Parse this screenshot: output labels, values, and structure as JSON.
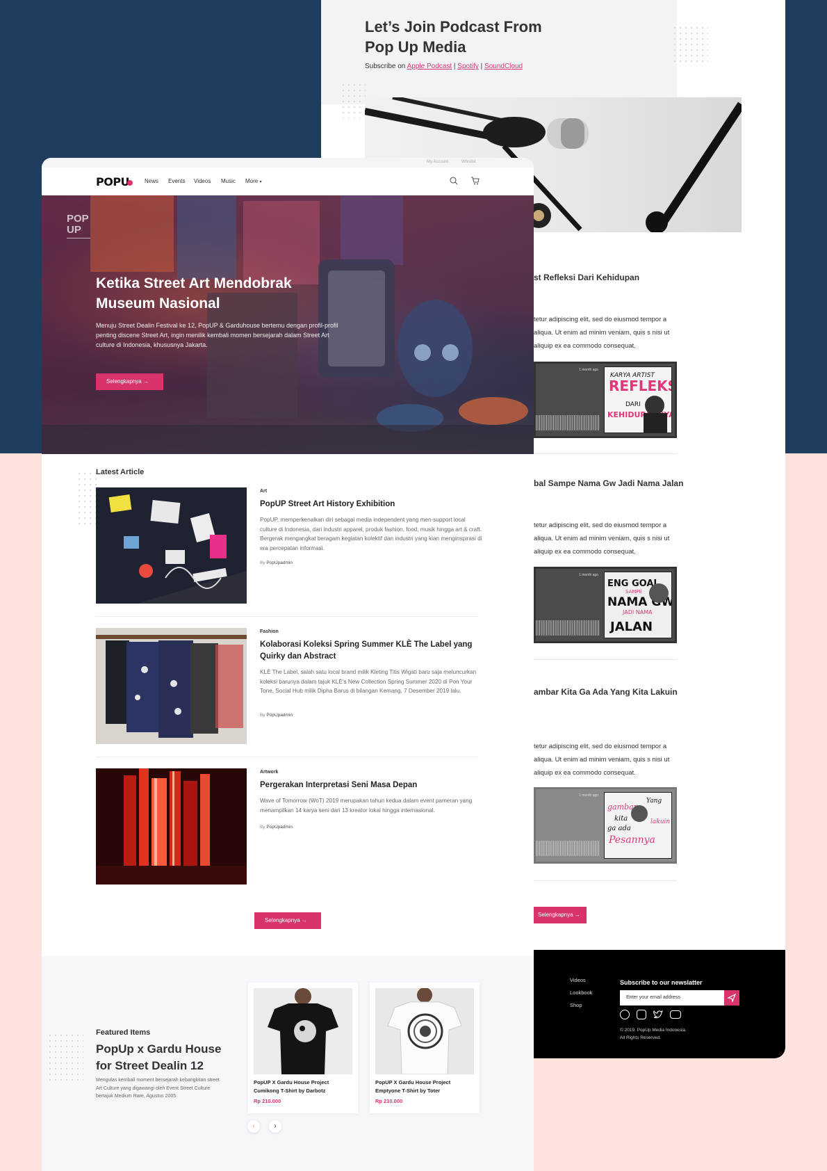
{
  "podcast": {
    "title": "Let’s Join Podcast From Pop Up Media",
    "subscribe_prefix": "Subscribe on",
    "platforms": [
      "Apple Podcast",
      "Spotify",
      "SoundCloud"
    ],
    "separator": "|",
    "episodes": [
      {
        "title": "st Refleksi Dari Kehidupan",
        "text": "tetur adipiscing elit, sed do eiusmod tempor a aliqua. Ut enim ad minim veniam, quis s nisi ut aliquip ex ea commodo consequat.",
        "ago": "1 month ago",
        "cover_text": "KARYA ARTIST REFLEKSI DARI KEHIDUPANNYA"
      },
      {
        "title": "bal Sampe Nama Gw Jadi Nama Jalan",
        "text": "tetur adipiscing elit, sed do eiusmod tempor a aliqua. Ut enim ad minim veniam, quis s nisi ut aliquip ex ea commodo consequat.",
        "ago": "1 month ago",
        "cover_text": "ENG GOAL SAMPE NAMA GW JADI NAMA JALAN"
      },
      {
        "title": "ambar Kita Ga Ada Yang Kita Lakuin",
        "text": "tetur adipiscing elit, sed do eiusmod tempor a aliqua. Ut enim ad minim veniam, quis s nisi ut aliquip ex ea commodo consequat.",
        "ago": "1 month ago",
        "cover_text": "gambar kita ga ada yang kita lakuin Pesannya"
      }
    ],
    "more_label": "Selengkapnya →"
  },
  "footer": {
    "links": [
      "Videos",
      "Lookbook",
      "Shop"
    ],
    "newsletter_title": "Subscribe to our newslatter",
    "email_placeholder": "Enter your email address",
    "copyright_line1": "© 2019. PopUp Media Indonesia.",
    "copyright_line2": "All Rights Reserved."
  },
  "topbar": {
    "account": "My Account",
    "wishlist": "Whislist"
  },
  "nav": {
    "logo": "POPU",
    "items": [
      "News",
      "Events",
      "Videos",
      "Music",
      "More"
    ],
    "more_caret": "▾"
  },
  "hero": {
    "logo": "POP UP",
    "title": "Ketika Street Art Mendobrak Museum Nasional",
    "text": "Menuju Street Dealin Festival ke 12, PopUP & Garduhouse bertemu dengan profil-profil penting discene Street Art, ingin menilik kembali momen bersejarah dalam Street Art culture di Indonesia, khususnya Jakarta.",
    "button": "Selengkapnya →"
  },
  "latest": {
    "heading": "Latest Article",
    "by_prefix": "By",
    "articles": [
      {
        "category": "Art",
        "title": "PopUP Street Art History Exhibition",
        "desc": "PopUP, memperkenalkan diri sebagai media independent yang men-support local culture di Indonesia, dari industri apparel, produk fashion, food, musik hingga art & craft. Bergerak mengangkat beragam kegiatan kolektif dan industri yang kian menginspirasi di era percepatan informasi.",
        "author": "PopUpadmin"
      },
      {
        "category": "Fashion",
        "title": "Kolaborasi Koleksi Spring Summer KLÈ The Label yang Quirky dan Abstract",
        "desc": "KLÈ The Label, salah satu local brand milik Kleting Titis Wigati baru saja meluncurkan koleksi barunya dalam tajuk KLÈ’s New Collection Spring Summer 2020 di Pon Your Tone, Social Hub milik Dipha Barus di bilangan Kemang, 7 Desember 2019 lalu.",
        "author": "PopUpadmin"
      },
      {
        "category": "Artwork",
        "title": "Pergerakan Interpretasi Seni Masa Depan",
        "desc": "Wave of Tomorrow (WoT) 2019 merupakan tahun kedua dalam event pameran yang menampilkan 14 karya seni dari 13 kreator lokal hingga internasional.",
        "author": "PopUpadmin"
      }
    ],
    "more_button": "Selengkapnya →"
  },
  "featured": {
    "label": "Featured Items",
    "title": "PopUp x Gardu House for Street Dealin 12",
    "desc": "Mengulas kembali moment bersejarah kebangkitan street Art Culture yang digawangi oleh Event Street Culture bertajuk Medium Rare, Agustus 2005.",
    "items": [
      {
        "name": "PopUP X Gardu House Project Cumikong T-Shirt by Darbotz",
        "price": "Rp 210.000"
      },
      {
        "name": "PopUP X Gardu House Project Emptyone T-Shirt by Toter",
        "price": "Rp 210.000"
      }
    ],
    "prev_icon": "‹",
    "next_icon": "›"
  },
  "colors": {
    "navy": "#1f3d5e",
    "pink_bg": "#fde2de",
    "accent": "#d8336b"
  }
}
